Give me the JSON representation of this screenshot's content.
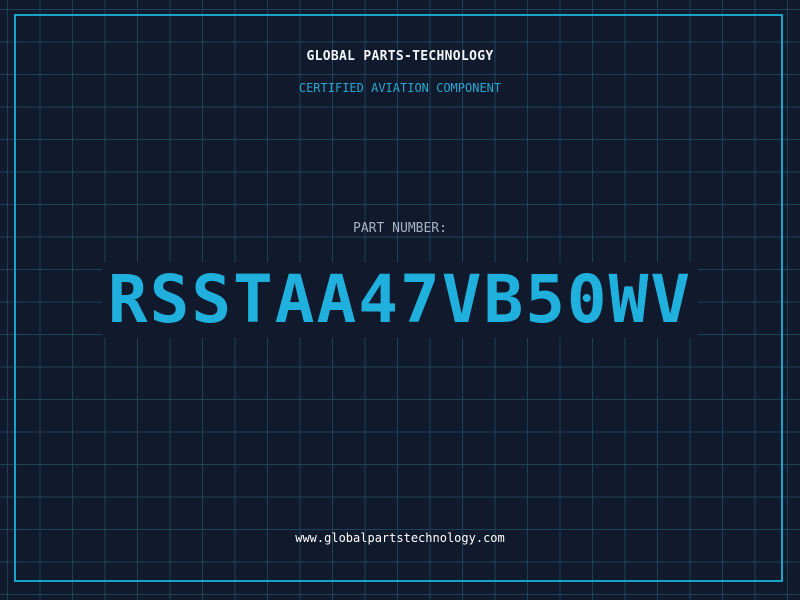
{
  "header": {
    "company": "GLOBAL PARTS-TECHNOLOGY",
    "subtitle": "CERTIFIED AVIATION COMPONENT"
  },
  "part": {
    "label": "PART NUMBER:",
    "number": "RSSTAA47VB50WV"
  },
  "footer": {
    "url": "www.globalpartstechnology.com"
  },
  "colors": {
    "background": "#111a2c",
    "grid": "#1c4258",
    "accent": "#1fb0dd"
  }
}
